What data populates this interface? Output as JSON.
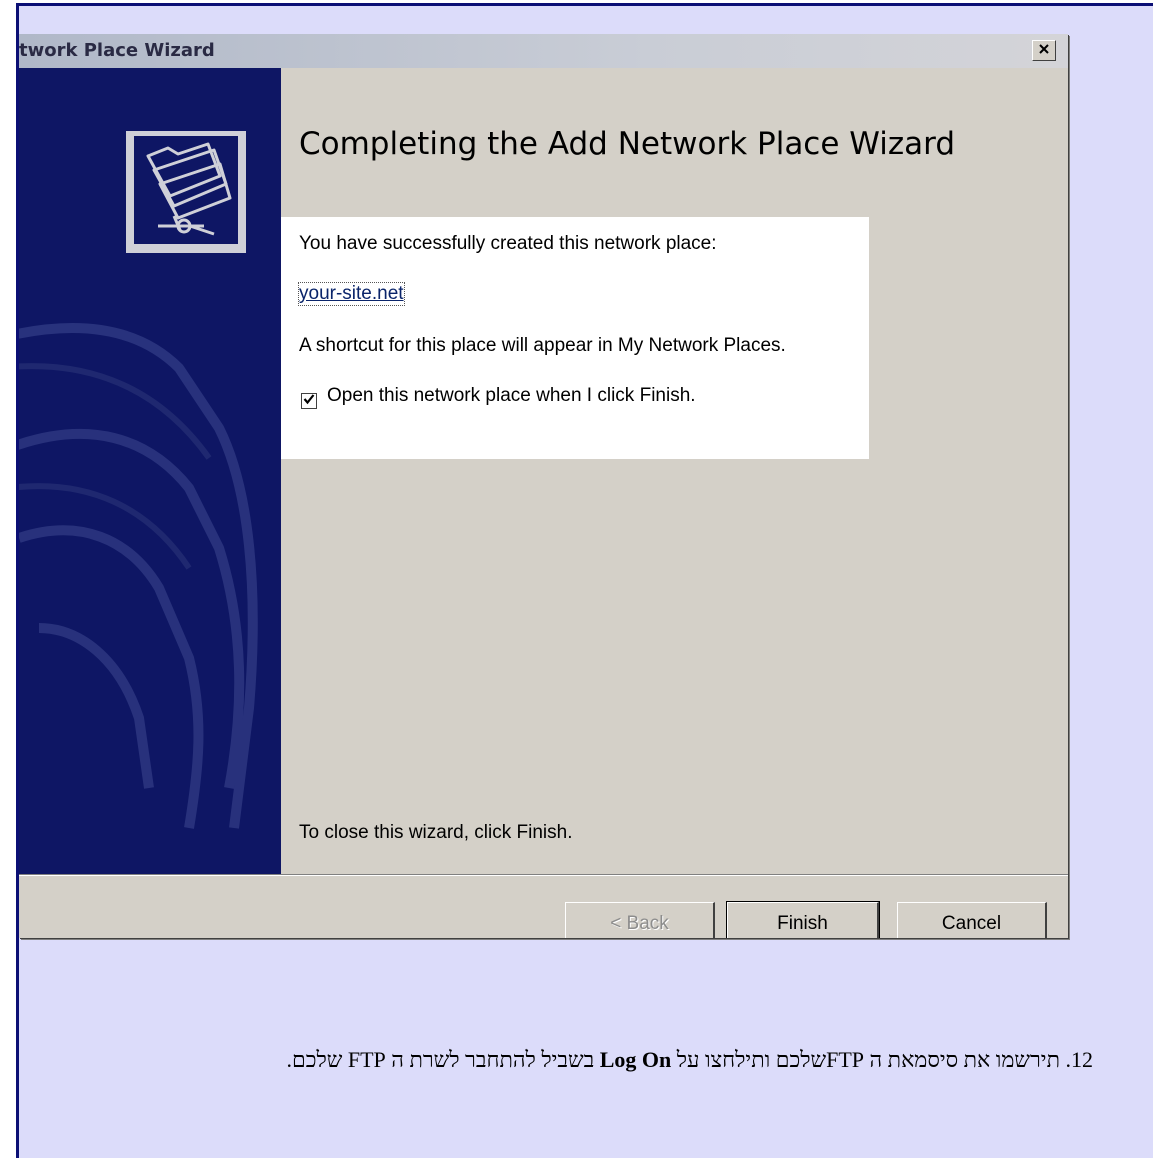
{
  "dialog": {
    "title": "twork Place Wizard",
    "close_label": "×",
    "heading": "Completing the Add Network Place Wizard",
    "success_text": "You have successfully created this network place:",
    "place_link": "your-site.net",
    "shortcut_text": "A shortcut for this place will appear in My Network Places.",
    "open_checkbox": {
      "label": "Open this network place when I click Finish.",
      "checked": true
    },
    "close_hint": "To close this wizard, click Finish.",
    "buttons": {
      "back": "< Back",
      "finish": "Finish",
      "cancel": "Cancel"
    }
  },
  "instruction": {
    "number": "12.",
    "text_before": " תירשמו את סיסמאת ה FTPשלכם ותילחצו על ",
    "bold": "Log On",
    "text_after": " בשביל להתחבר לשרת ה FTP שלכם."
  },
  "colors": {
    "page_background": "#dcdcfa",
    "page_border": "#0b0f75",
    "sidebar": "#0e1664",
    "dialog_face": "#d4d0c8"
  },
  "icons": [
    "wizard-network-folder-icon",
    "close-icon",
    "checkmark-icon"
  ]
}
